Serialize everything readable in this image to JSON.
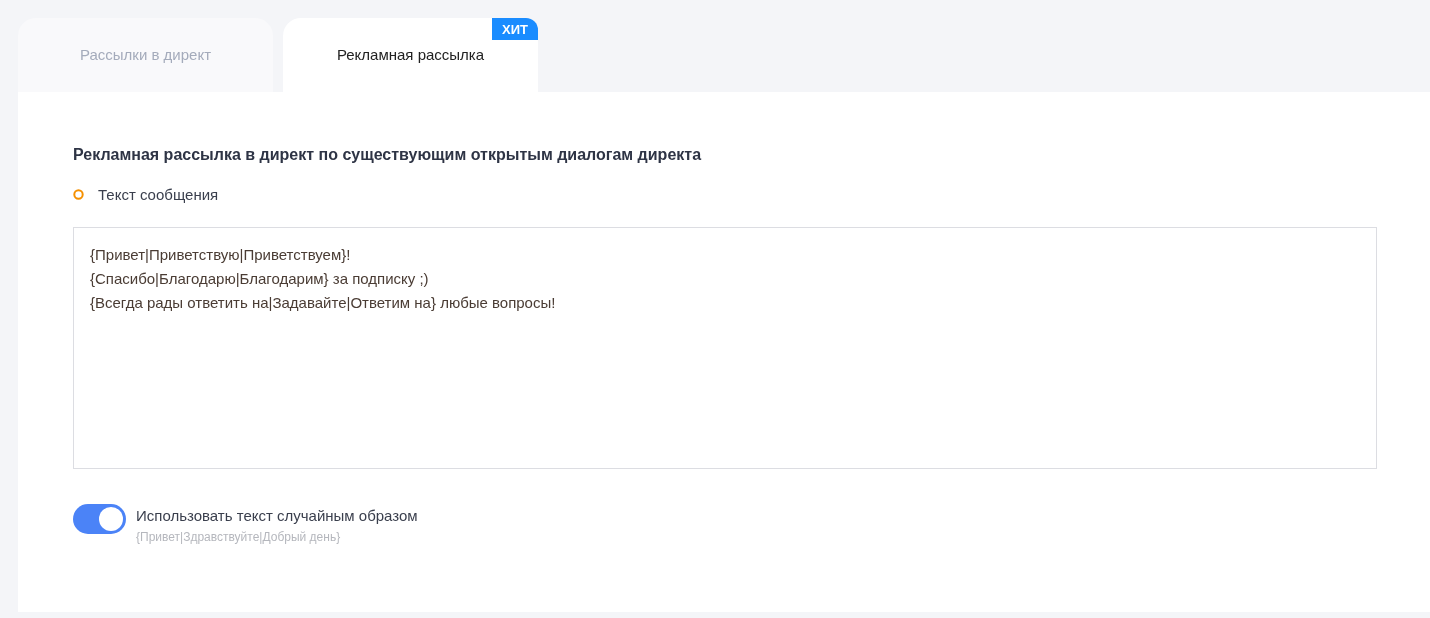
{
  "tabs": [
    {
      "label": "Рассылки в директ",
      "selected": false
    },
    {
      "label": "Рекламная рассылка",
      "selected": true,
      "badge": "ХИТ"
    }
  ],
  "panel": {
    "heading": "Рекламная рассылка в директ по существующим открытым диалогам директа",
    "message_label": "Текст сообщения",
    "message": {
      "value": "{Привет|Приветствую|Приветствуем}!\n{Спасибо|Благодарю|Благодарим} за подписку ;)\n{Всегда рады ответить на|Задавайте|Ответим на} любые вопросы!"
    },
    "random_toggle": {
      "label": "Использовать текст случайным образом",
      "hint": "{Привет|Здравствуйте|Добрый день}",
      "on": true
    }
  }
}
